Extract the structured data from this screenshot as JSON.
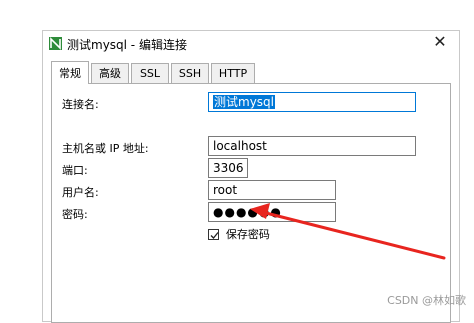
{
  "window": {
    "title": "测试mysql - 编辑连接",
    "close_glyph": "✕"
  },
  "tabs": [
    {
      "label": "常规",
      "active": true
    },
    {
      "label": "高级",
      "active": false
    },
    {
      "label": "SSL",
      "active": false
    },
    {
      "label": "SSH",
      "active": false
    },
    {
      "label": "HTTP",
      "active": false
    }
  ],
  "form": {
    "connection_name": {
      "label": "连接名:",
      "value": "测试mysql"
    },
    "host": {
      "label": "主机名或 IP 地址:",
      "value": "localhost"
    },
    "port": {
      "label": "端口:",
      "value": "3306"
    },
    "username": {
      "label": "用户名:",
      "value": "root"
    },
    "password": {
      "label": "密码:",
      "value": "●●●●●●"
    },
    "save_password": {
      "label": "保存密码",
      "checked": true
    }
  },
  "annotation": {
    "arrow_color": "#e8251f"
  },
  "watermark": "CSDN @林如歌",
  "colors": {
    "accent": "#0078d7",
    "app_icon_green": "#2e8b3a"
  }
}
